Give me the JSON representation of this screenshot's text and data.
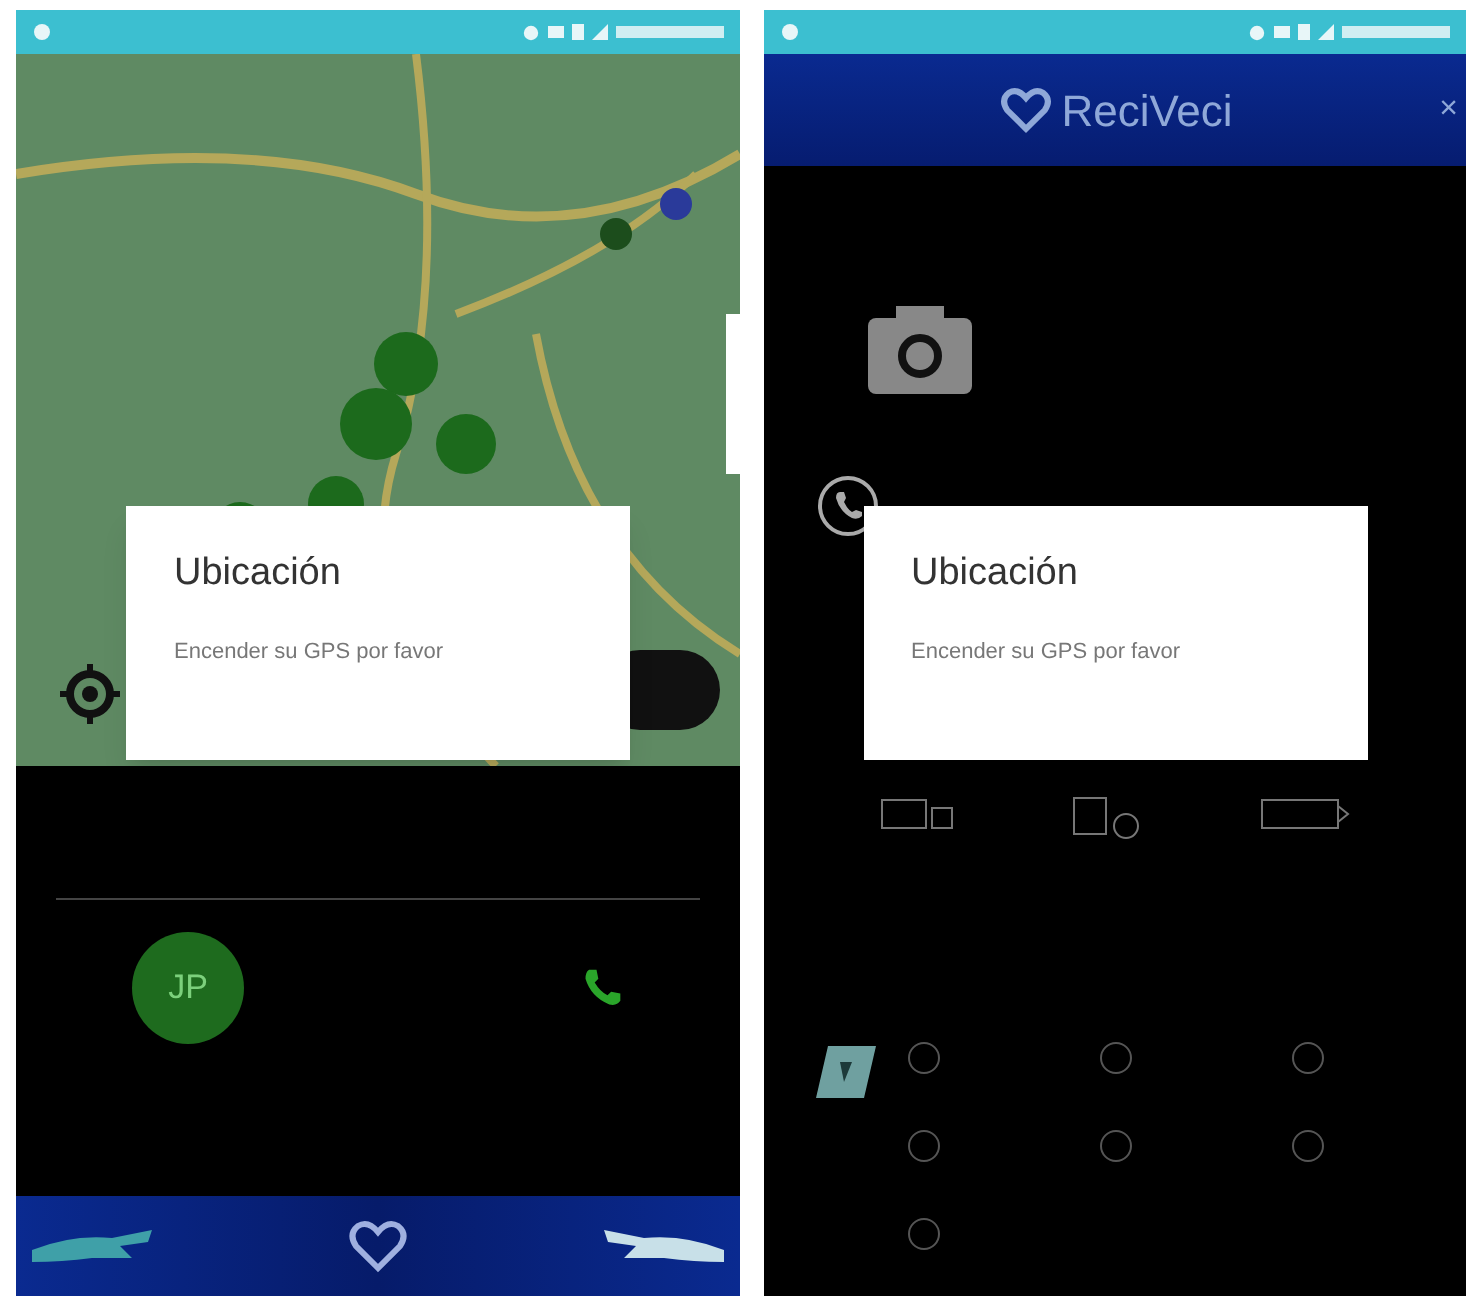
{
  "screens": [
    {
      "kind": "map",
      "dialog": {
        "title": "Ubicación",
        "message": "Encender su GPS por favor"
      },
      "avatar": "JP"
    },
    {
      "kind": "form",
      "header": {
        "title": "ReciVeci",
        "close": "×"
      },
      "dialog": {
        "title": "Ubicación",
        "message": "Encender su GPS por favor"
      },
      "checkboxes": [
        {
          "checked": false
        },
        {
          "checked": false
        },
        {
          "checked": false
        },
        {
          "checked": false
        },
        {
          "checked": false
        },
        {
          "checked": false
        },
        {
          "checked": false
        }
      ]
    }
  ]
}
